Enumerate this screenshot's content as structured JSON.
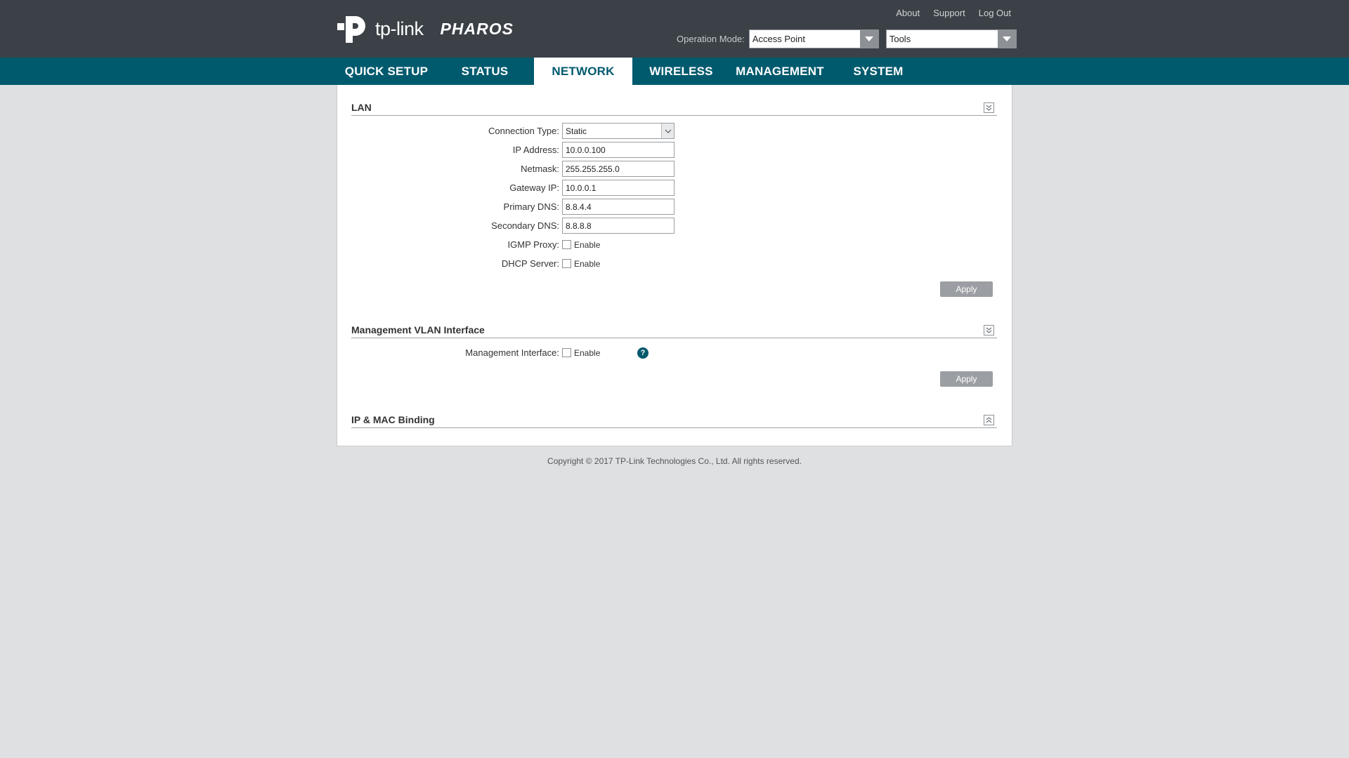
{
  "header": {
    "logo_text": "tp-link",
    "product_name": "PHAROS",
    "links": {
      "about": "About",
      "support": "Support",
      "logout": "Log Out"
    },
    "operation_mode_label": "Operation Mode:",
    "operation_mode_value": "Access Point",
    "tools_value": "Tools"
  },
  "nav": {
    "tabs": [
      "QUICK SETUP",
      "STATUS",
      "NETWORK",
      "WIRELESS",
      "MANAGEMENT",
      "SYSTEM"
    ],
    "active": "NETWORK"
  },
  "lan": {
    "title": "LAN",
    "connection_type_label": "Connection Type:",
    "connection_type_value": "Static",
    "ip_label": "IP Address:",
    "ip_value": "10.0.0.100",
    "netmask_label": "Netmask:",
    "netmask_value": "255.255.255.0",
    "gateway_label": "Gateway IP:",
    "gateway_value": "10.0.0.1",
    "primary_dns_label": "Primary DNS:",
    "primary_dns_value": "8.8.4.4",
    "secondary_dns_label": "Secondary DNS:",
    "secondary_dns_value": "8.8.8.8",
    "igmp_label": "IGMP Proxy:",
    "igmp_enable": "Enable",
    "dhcp_label": "DHCP Server:",
    "dhcp_enable": "Enable",
    "apply_label": "Apply"
  },
  "vlan": {
    "title": "Management VLAN Interface",
    "interface_label": "Management Interface:",
    "interface_enable": "Enable",
    "help_glyph": "?",
    "apply_label": "Apply"
  },
  "binding": {
    "title": "IP & MAC Binding"
  },
  "footer": {
    "copyright": "Copyright © 2017 TP-Link Technologies Co., Ltd. All rights reserved."
  },
  "colors": {
    "header_bg": "#3b4146",
    "nav_bg": "#005a6e",
    "page_bg": "#dfe0e2",
    "button_gray": "#9b9ea2"
  }
}
